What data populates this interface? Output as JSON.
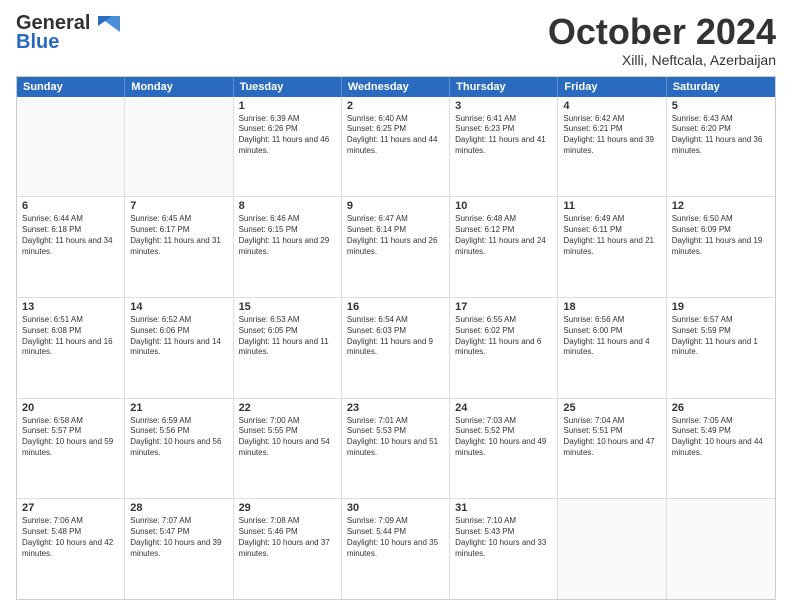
{
  "header": {
    "logo_general": "General",
    "logo_blue": "Blue",
    "month_title": "October 2024",
    "location": "Xilli, Neftcala, Azerbaijan"
  },
  "weekdays": [
    "Sunday",
    "Monday",
    "Tuesday",
    "Wednesday",
    "Thursday",
    "Friday",
    "Saturday"
  ],
  "rows": [
    [
      {
        "day": "",
        "sunrise": "",
        "sunset": "",
        "daylight": ""
      },
      {
        "day": "",
        "sunrise": "",
        "sunset": "",
        "daylight": ""
      },
      {
        "day": "1",
        "sunrise": "Sunrise: 6:39 AM",
        "sunset": "Sunset: 6:26 PM",
        "daylight": "Daylight: 11 hours and 46 minutes."
      },
      {
        "day": "2",
        "sunrise": "Sunrise: 6:40 AM",
        "sunset": "Sunset: 6:25 PM",
        "daylight": "Daylight: 11 hours and 44 minutes."
      },
      {
        "day": "3",
        "sunrise": "Sunrise: 6:41 AM",
        "sunset": "Sunset: 6:23 PM",
        "daylight": "Daylight: 11 hours and 41 minutes."
      },
      {
        "day": "4",
        "sunrise": "Sunrise: 6:42 AM",
        "sunset": "Sunset: 6:21 PM",
        "daylight": "Daylight: 11 hours and 39 minutes."
      },
      {
        "day": "5",
        "sunrise": "Sunrise: 6:43 AM",
        "sunset": "Sunset: 6:20 PM",
        "daylight": "Daylight: 11 hours and 36 minutes."
      }
    ],
    [
      {
        "day": "6",
        "sunrise": "Sunrise: 6:44 AM",
        "sunset": "Sunset: 6:18 PM",
        "daylight": "Daylight: 11 hours and 34 minutes."
      },
      {
        "day": "7",
        "sunrise": "Sunrise: 6:45 AM",
        "sunset": "Sunset: 6:17 PM",
        "daylight": "Daylight: 11 hours and 31 minutes."
      },
      {
        "day": "8",
        "sunrise": "Sunrise: 6:46 AM",
        "sunset": "Sunset: 6:15 PM",
        "daylight": "Daylight: 11 hours and 29 minutes."
      },
      {
        "day": "9",
        "sunrise": "Sunrise: 6:47 AM",
        "sunset": "Sunset: 6:14 PM",
        "daylight": "Daylight: 11 hours and 26 minutes."
      },
      {
        "day": "10",
        "sunrise": "Sunrise: 6:48 AM",
        "sunset": "Sunset: 6:12 PM",
        "daylight": "Daylight: 11 hours and 24 minutes."
      },
      {
        "day": "11",
        "sunrise": "Sunrise: 6:49 AM",
        "sunset": "Sunset: 6:11 PM",
        "daylight": "Daylight: 11 hours and 21 minutes."
      },
      {
        "day": "12",
        "sunrise": "Sunrise: 6:50 AM",
        "sunset": "Sunset: 6:09 PM",
        "daylight": "Daylight: 11 hours and 19 minutes."
      }
    ],
    [
      {
        "day": "13",
        "sunrise": "Sunrise: 6:51 AM",
        "sunset": "Sunset: 6:08 PM",
        "daylight": "Daylight: 11 hours and 16 minutes."
      },
      {
        "day": "14",
        "sunrise": "Sunrise: 6:52 AM",
        "sunset": "Sunset: 6:06 PM",
        "daylight": "Daylight: 11 hours and 14 minutes."
      },
      {
        "day": "15",
        "sunrise": "Sunrise: 6:53 AM",
        "sunset": "Sunset: 6:05 PM",
        "daylight": "Daylight: 11 hours and 11 minutes."
      },
      {
        "day": "16",
        "sunrise": "Sunrise: 6:54 AM",
        "sunset": "Sunset: 6:03 PM",
        "daylight": "Daylight: 11 hours and 9 minutes."
      },
      {
        "day": "17",
        "sunrise": "Sunrise: 6:55 AM",
        "sunset": "Sunset: 6:02 PM",
        "daylight": "Daylight: 11 hours and 6 minutes."
      },
      {
        "day": "18",
        "sunrise": "Sunrise: 6:56 AM",
        "sunset": "Sunset: 6:00 PM",
        "daylight": "Daylight: 11 hours and 4 minutes."
      },
      {
        "day": "19",
        "sunrise": "Sunrise: 6:57 AM",
        "sunset": "Sunset: 5:59 PM",
        "daylight": "Daylight: 11 hours and 1 minute."
      }
    ],
    [
      {
        "day": "20",
        "sunrise": "Sunrise: 6:58 AM",
        "sunset": "Sunset: 5:57 PM",
        "daylight": "Daylight: 10 hours and 59 minutes."
      },
      {
        "day": "21",
        "sunrise": "Sunrise: 6:59 AM",
        "sunset": "Sunset: 5:56 PM",
        "daylight": "Daylight: 10 hours and 56 minutes."
      },
      {
        "day": "22",
        "sunrise": "Sunrise: 7:00 AM",
        "sunset": "Sunset: 5:55 PM",
        "daylight": "Daylight: 10 hours and 54 minutes."
      },
      {
        "day": "23",
        "sunrise": "Sunrise: 7:01 AM",
        "sunset": "Sunset: 5:53 PM",
        "daylight": "Daylight: 10 hours and 51 minutes."
      },
      {
        "day": "24",
        "sunrise": "Sunrise: 7:03 AM",
        "sunset": "Sunset: 5:52 PM",
        "daylight": "Daylight: 10 hours and 49 minutes."
      },
      {
        "day": "25",
        "sunrise": "Sunrise: 7:04 AM",
        "sunset": "Sunset: 5:51 PM",
        "daylight": "Daylight: 10 hours and 47 minutes."
      },
      {
        "day": "26",
        "sunrise": "Sunrise: 7:05 AM",
        "sunset": "Sunset: 5:49 PM",
        "daylight": "Daylight: 10 hours and 44 minutes."
      }
    ],
    [
      {
        "day": "27",
        "sunrise": "Sunrise: 7:06 AM",
        "sunset": "Sunset: 5:48 PM",
        "daylight": "Daylight: 10 hours and 42 minutes."
      },
      {
        "day": "28",
        "sunrise": "Sunrise: 7:07 AM",
        "sunset": "Sunset: 5:47 PM",
        "daylight": "Daylight: 10 hours and 39 minutes."
      },
      {
        "day": "29",
        "sunrise": "Sunrise: 7:08 AM",
        "sunset": "Sunset: 5:46 PM",
        "daylight": "Daylight: 10 hours and 37 minutes."
      },
      {
        "day": "30",
        "sunrise": "Sunrise: 7:09 AM",
        "sunset": "Sunset: 5:44 PM",
        "daylight": "Daylight: 10 hours and 35 minutes."
      },
      {
        "day": "31",
        "sunrise": "Sunrise: 7:10 AM",
        "sunset": "Sunset: 5:43 PM",
        "daylight": "Daylight: 10 hours and 33 minutes."
      },
      {
        "day": "",
        "sunrise": "",
        "sunset": "",
        "daylight": ""
      },
      {
        "day": "",
        "sunrise": "",
        "sunset": "",
        "daylight": ""
      }
    ]
  ]
}
